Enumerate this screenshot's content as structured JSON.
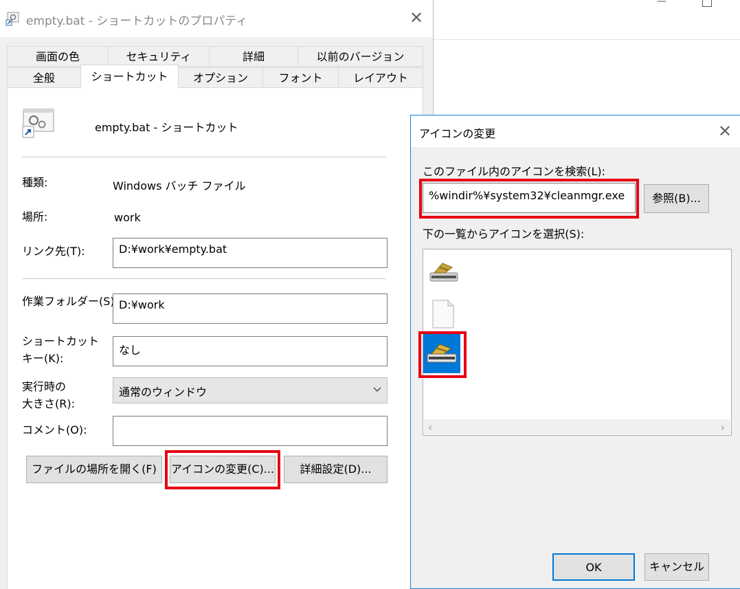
{
  "properties": {
    "title": "empty.bat - ショートカットのプロパティ",
    "tabs_row1": [
      "画面の色",
      "セキュリティ",
      "詳細",
      "以前のバージョン"
    ],
    "tabs_row2": [
      "全般",
      "ショートカット",
      "オプション",
      "フォント",
      "レイアウト"
    ],
    "active_tab": "ショートカット",
    "shortcut_name": "empty.bat - ショートカット",
    "type_label": "種類:",
    "type_value": "Windows バッチ ファイル",
    "location_label": "場所:",
    "location_value": "work",
    "target_label": "リンク先(T):",
    "target_value": "D:¥work¥empty.bat",
    "workdir_label": "作業フォルダー(S):",
    "workdir_value": "D:¥work",
    "hotkey_label_line1": "ショートカット",
    "hotkey_label_line2": "キー(K):",
    "hotkey_value": "なし",
    "run_label_line1": "実行時の",
    "run_label_line2": "大きさ(R):",
    "run_value": "通常のウィンドウ",
    "comment_label": "コメント(O):",
    "comment_value": "",
    "btn_open_location": "ファイルの場所を開く(F)",
    "btn_change_icon": "アイコンの変更(C)...",
    "btn_advanced": "詳細設定(D)..."
  },
  "change_icon": {
    "title": "アイコンの変更",
    "search_label": "このファイル内のアイコンを検索(L):",
    "search_value": "%windir%¥system32¥cleanmgr.exe",
    "browse_button": "参照(B)...",
    "list_label": "下の一覧からアイコンを選択(S):",
    "icons": [
      "cleanmgr-drive-icon",
      "blank-document-icon",
      "cleanmgr-drive-selected-icon"
    ],
    "selected_index": 2,
    "ok_button": "OK",
    "cancel_button": "キャンセル"
  },
  "colors": {
    "highlight_red": "#e60012",
    "selection_blue": "#0078d7",
    "dialog_border": "#1883d7"
  }
}
